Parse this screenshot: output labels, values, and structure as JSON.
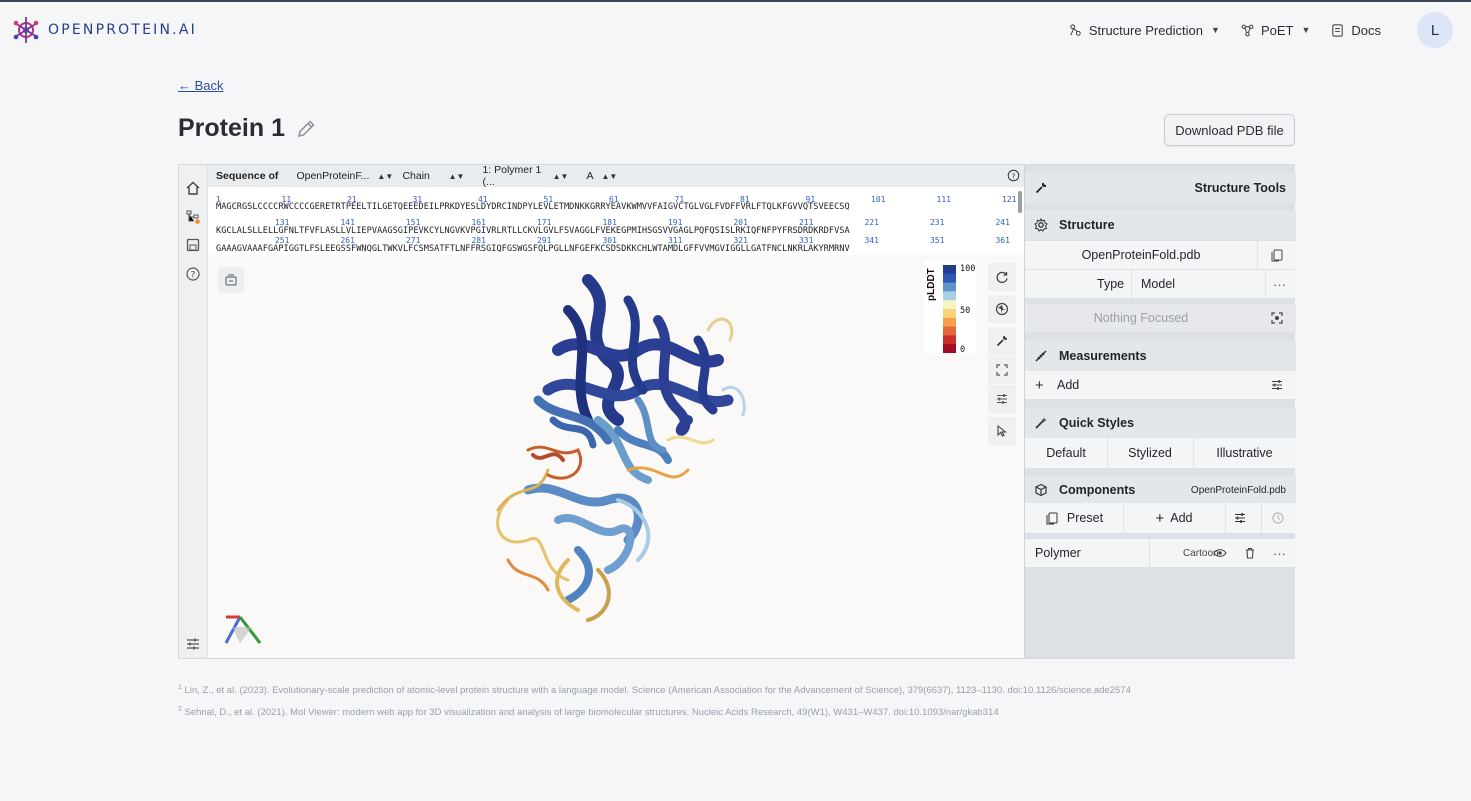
{
  "brand": {
    "name": "OPENPROTEIN.AI"
  },
  "nav": {
    "structure_prediction": "Structure Prediction",
    "poet": "PoET",
    "docs": "Docs",
    "avatar_letter": "L"
  },
  "page": {
    "back": "← Back",
    "title": "Protein 1",
    "download": "Download PDB file"
  },
  "sequence": {
    "label": "Sequence of",
    "source": "OpenProteinF...",
    "mode": "Chain",
    "polymer": "1: Polymer 1 (...",
    "chain": "A",
    "lines": [
      "MAGCRGSLCCCCRWCCCCGERETRTPEELTILGETQEEEDEILPRKDYESLDYDRCINDPYLEVLETMDNKKGRRYEAVKWMVVFAIGVCTGLVGLFVDFFVRLFTQLKFGVVQTSVEECSQ",
      "KGCLALSLLELLGFNLTFVFLASLLVLIEPVAAGSGIPEVKCYLNGVKVPGIVRLRTLLCKVLGVLFSVAGGLFVEKEGPMIHSGSVVGAGLPQFQSISLRKIQFNFPYFRSDRDKRDFVSA",
      "GAAAGVAAAFGAPIGGTLFSLEEGSSFWNQGLTWKVLFCSMSATFTLNFFRSGIQFGSWGSFQLPGLLNFGEFKCSDSDKKCHLWTAMDLGFFVVMGVIGGLLGATFNCLNKRLAKYRMRNV"
    ],
    "numbers_row1": [
      "1",
      "11",
      "21",
      "31",
      "41",
      "51",
      "61",
      "71",
      "81",
      "91",
      "101",
      "111",
      "121"
    ],
    "numbers_row2": [
      "131",
      "141",
      "151",
      "161",
      "171",
      "181",
      "191",
      "201",
      "211",
      "221",
      "231",
      "241"
    ],
    "numbers_row3": [
      "251",
      "261",
      "271",
      "281",
      "291",
      "301",
      "311",
      "321",
      "331",
      "341",
      "351",
      "361"
    ]
  },
  "legend": {
    "label": "pLDDT",
    "high": "100",
    "mid": "50",
    "low": "0"
  },
  "legend_colors": [
    "#243a8f",
    "#2d57b0",
    "#5e94cc",
    "#a9d0e6",
    "#f5f4c0",
    "#f8d57a",
    "#f59f4f",
    "#e6653c",
    "#c8302a",
    "#a10b26"
  ],
  "panel": {
    "structure_tools": "Structure Tools",
    "structure": "Structure",
    "file": "OpenProteinFold.pdb",
    "type_label": "Type",
    "type_value": "Model",
    "focus": "Nothing Focused",
    "measurements": "Measurements",
    "add": "Add",
    "quick_styles": "Quick Styles",
    "style_default": "Default",
    "style_stylized": "Stylized",
    "style_illustrative": "Illustrative",
    "components": "Components",
    "components_file": "OpenProteinFold.pdb",
    "preset": "Preset",
    "add2": "Add",
    "polymer": "Polymer",
    "representation": "Cartoon"
  },
  "footnotes": [
    {
      "mark": "1",
      "text": "Lin, Z., et al. (2023). Evolutionary-scale prediction of atomic-level protein structure with a language model. Science (American Association for the Advancement of Science), 379(6637), 1123–1130. doi:10.1126/science.ade2574"
    },
    {
      "mark": "2",
      "text": "Sehnal, D., et al. (2021). Mol Viewer: modern web app for 3D visualization and analysis of large biomolecular structures. Nucleic Acids Research, 49(W1), W431–W437. doi:10.1093/nar/gkab314"
    }
  ]
}
